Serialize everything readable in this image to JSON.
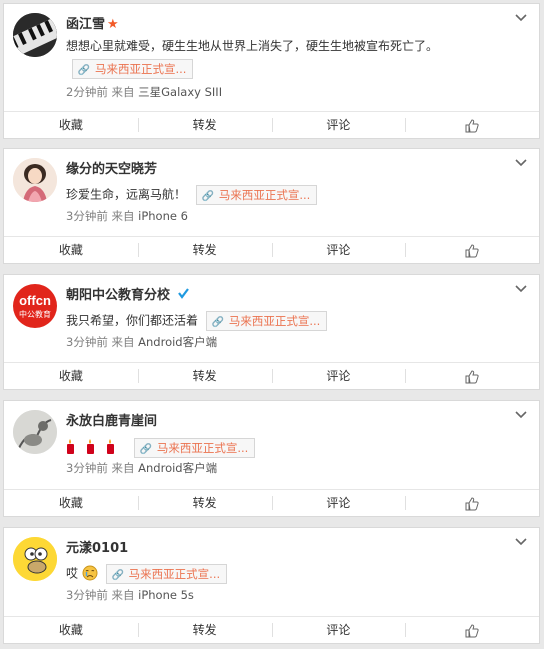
{
  "posts": [
    {
      "name": "函江雪",
      "text": "想想心里就难受，硬生生地从世界上消失了，硬生生地被宣布死亡了。",
      "tag": "马来西亚正式宣...",
      "time": "2分钟前",
      "from": "来自",
      "source": "三星Galaxy SIII",
      "badge": "★"
    },
    {
      "name": "缘分的天空晓芳",
      "text": "珍爱生命，远离马航！",
      "tag": "马来西亚正式宣...",
      "time": "3分钟前",
      "from": "来自",
      "source": "iPhone 6"
    },
    {
      "name": "朝阳中公教育分校",
      "text": "我只希望，你们都还活着",
      "tag": "马来西亚正式宣...",
      "time": "3分钟前",
      "from": "来自",
      "source": "Android客户端",
      "avatar_top": "offcn",
      "avatar_bottom": "中公教育"
    },
    {
      "name": "永放白鹿青崖间",
      "text": "",
      "tag": "马来西亚正式宣...",
      "time": "3分钟前",
      "from": "来自",
      "source": "Android客户端"
    },
    {
      "name": "元漾0101",
      "text": "哎",
      "tag": "马来西亚正式宣...",
      "time": "3分钟前",
      "from": "来自",
      "source": "iPhone 5s"
    }
  ],
  "actions": {
    "favorite": "收藏",
    "repost": "转发",
    "comment": "评论"
  },
  "icons": {
    "expand": "chevron-down-icon",
    "link": "link-icon",
    "like": "thumbs-up-icon",
    "verified": "verified-icon",
    "candle": "candle-emoji-icon",
    "cry": "cry-emoji-icon",
    "star": "star-badge-icon"
  },
  "colors": {
    "tag_text": "#eb7350",
    "verified": "#1f9ae0",
    "star": "#f25a28",
    "offcn": "#e1251b"
  }
}
